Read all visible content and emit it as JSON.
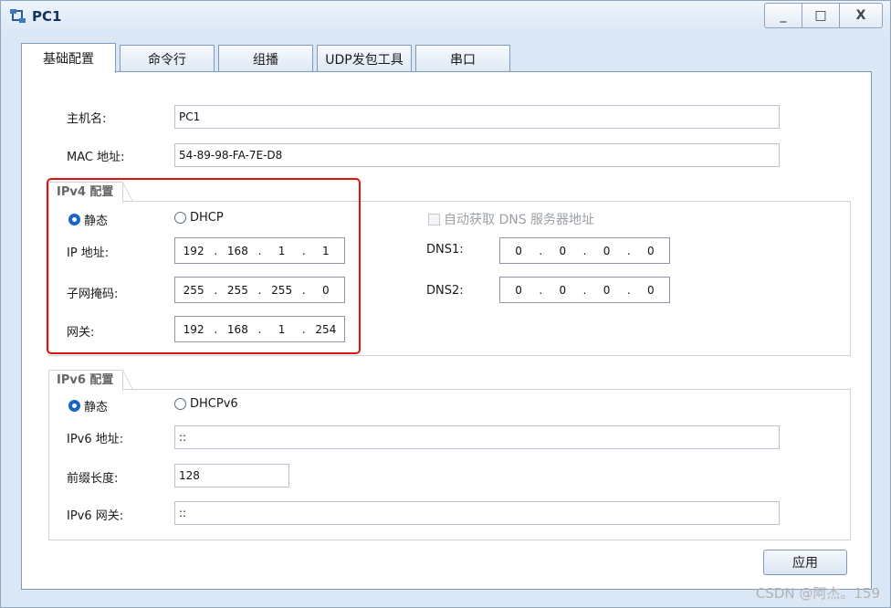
{
  "window": {
    "title": "PC1",
    "controls": {
      "minimize": "_",
      "maximize": "□",
      "close": "X"
    }
  },
  "tabs": [
    {
      "label": "基础配置",
      "active": true
    },
    {
      "label": "命令行",
      "active": false
    },
    {
      "label": "组播",
      "active": false
    },
    {
      "label": "UDP发包工具",
      "active": false
    },
    {
      "label": "串口",
      "active": false
    }
  ],
  "basic": {
    "hostname_label": "主机名:",
    "hostname_value": "PC1",
    "mac_label": "MAC 地址:",
    "mac_value": "54-89-98-FA-7E-D8"
  },
  "ipv4": {
    "title": "IPv4 配置",
    "static_label": "静态",
    "dhcp_label": "DHCP",
    "auto_dns_label": "自动获取 DNS 服务器地址",
    "ip_label": "IP 地址:",
    "ip_value": [
      "192",
      "168",
      "1",
      "1"
    ],
    "mask_label": "子网掩码:",
    "mask_value": [
      "255",
      "255",
      "255",
      "0"
    ],
    "gateway_label": "网关:",
    "gateway_value": [
      "192",
      "168",
      "1",
      "254"
    ],
    "dns1_label": "DNS1:",
    "dns1_value": [
      "0",
      "0",
      "0",
      "0"
    ],
    "dns2_label": "DNS2:",
    "dns2_value": [
      "0",
      "0",
      "0",
      "0"
    ]
  },
  "ipv6": {
    "title": "IPv6 配置",
    "static_label": "静态",
    "dhcp_label": "DHCPv6",
    "addr_label": "IPv6 地址:",
    "addr_value": "::",
    "prefix_label": "前缀长度:",
    "prefix_value": "128",
    "gateway_label": "IPv6 网关:",
    "gateway_value": "::"
  },
  "apply_label": "应用",
  "watermark": "CSDN @阿杰。159",
  "colors": {
    "radio_selected": "#1765c7",
    "highlight": "#e3120e"
  }
}
